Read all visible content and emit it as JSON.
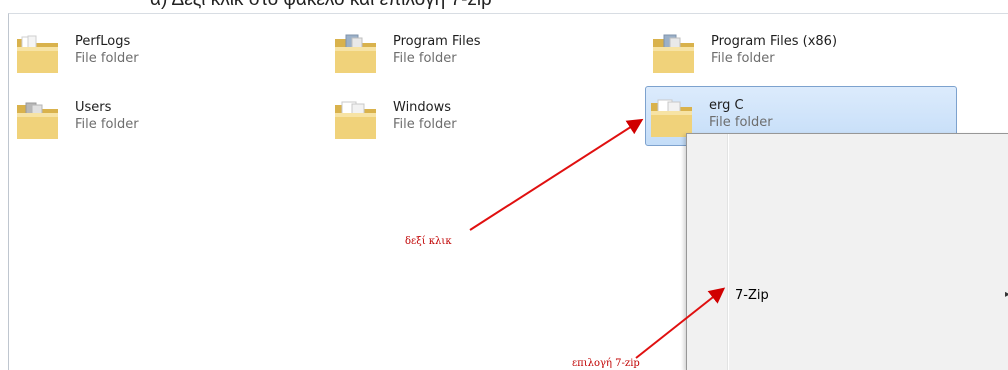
{
  "caption": "α)   Δεξί κλικ στο φάκελο και επιλογή 7-zip",
  "folders": [
    {
      "name": "PerfLogs",
      "type": "File folder"
    },
    {
      "name": "Program Files",
      "type": "File folder"
    },
    {
      "name": "Program Files (x86)",
      "type": "File folder"
    },
    {
      "name": "Users",
      "type": "File folder"
    },
    {
      "name": "Windows",
      "type": "File folder"
    },
    {
      "name": "erg C",
      "type": "File folder",
      "selected": true
    }
  ],
  "context_menu": {
    "items": [
      {
        "label": "7-Zip",
        "has_submenu": true
      }
    ]
  },
  "annotations": {
    "right_click": "δεξί κλικ",
    "select_7zip": "επιλογή 7-zip"
  },
  "colors": {
    "annotation": "#c00000",
    "selection": "#c4ddf8",
    "selection_border": "#7da2ce"
  }
}
